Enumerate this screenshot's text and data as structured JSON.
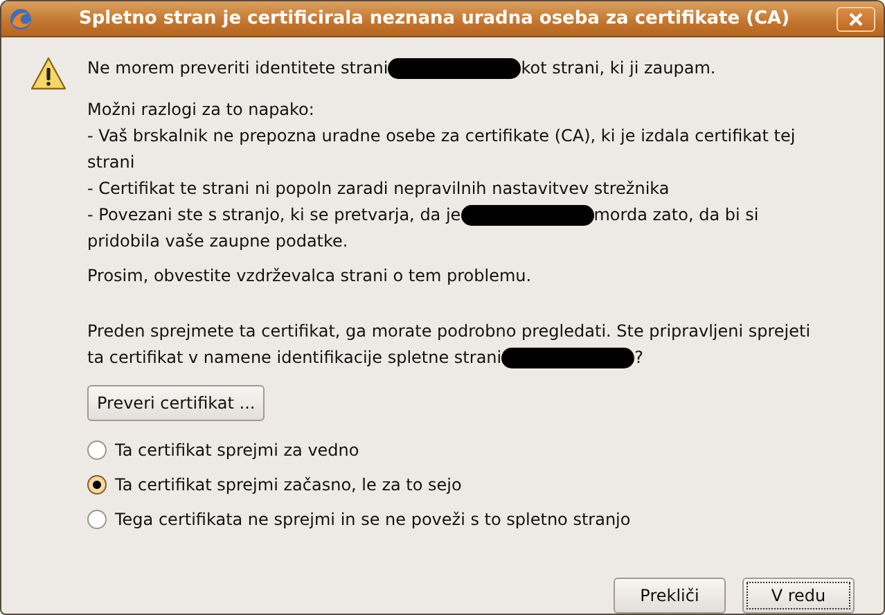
{
  "window": {
    "title": "Spletno stran je certificirala neznana uradna oseba za certifikate (CA)"
  },
  "message": {
    "paragraphs": [
      {
        "kind": "lead",
        "lines": [
          [
            {
              "kind": "text",
              "text": "Ne morem preveriti identitete strani "
            },
            {
              "kind": "redaction"
            },
            {
              "kind": "text",
              "text": " kot strani, ki ji zaupam."
            }
          ]
        ]
      },
      {
        "kind": "para",
        "lines": [
          [
            {
              "kind": "text",
              "text": "Možni razlogi za to napako:"
            }
          ]
        ]
      },
      {
        "kind": "item",
        "lines": [
          [
            {
              "kind": "text",
              "text": "- Vaš brskalnik ne prepozna uradne osebe za certifikate (CA), ki je izdala certifikat tej"
            }
          ],
          [
            {
              "kind": "text",
              "text": "strani"
            }
          ]
        ]
      },
      {
        "kind": "item",
        "lines": [
          [
            {
              "kind": "text",
              "text": "- Certifikat te strani ni popoln zaradi nepravilnih nastavitvev strežnika"
            }
          ]
        ]
      },
      {
        "kind": "item",
        "lines": [
          [
            {
              "kind": "text",
              "text": "- Povezani ste s stranjo, ki se pretvarja, da je"
            },
            {
              "kind": "redaction"
            },
            {
              "kind": "text",
              "text": " morda zato, da bi si"
            }
          ],
          [
            {
              "kind": "text",
              "text": "pridobila vaše zaupne podatke."
            }
          ]
        ]
      },
      {
        "kind": "para",
        "lines": [
          [
            {
              "kind": "text",
              "text": "Prosim, obvestite vzdrževalca strani o tem problemu."
            }
          ]
        ]
      },
      {
        "kind": "question",
        "lines": [
          [
            {
              "kind": "text",
              "text": "Preden sprejmete ta certifikat, ga morate podrobno pregledati. Ste pripravljeni sprejeti"
            }
          ],
          [
            {
              "kind": "text",
              "text": "ta certifikat v namene identifikacije spletne strani"
            },
            {
              "kind": "redaction"
            },
            {
              "kind": "text",
              "text": "?"
            }
          ]
        ]
      }
    ]
  },
  "examine_button": {
    "label": "Preveri certifikat ..."
  },
  "options": [
    {
      "label": "Ta certifikat sprejmi za vedno",
      "selected": false
    },
    {
      "label": "Ta certifikat sprejmi začasno, le za to sejo",
      "selected": true
    },
    {
      "label": "Tega certifikata ne sprejmi in se ne poveži s to spletno stranjo",
      "selected": false
    }
  ],
  "buttons": [
    {
      "label": "Prekliči",
      "focused": false
    },
    {
      "label": "V redu",
      "focused": true
    }
  ]
}
